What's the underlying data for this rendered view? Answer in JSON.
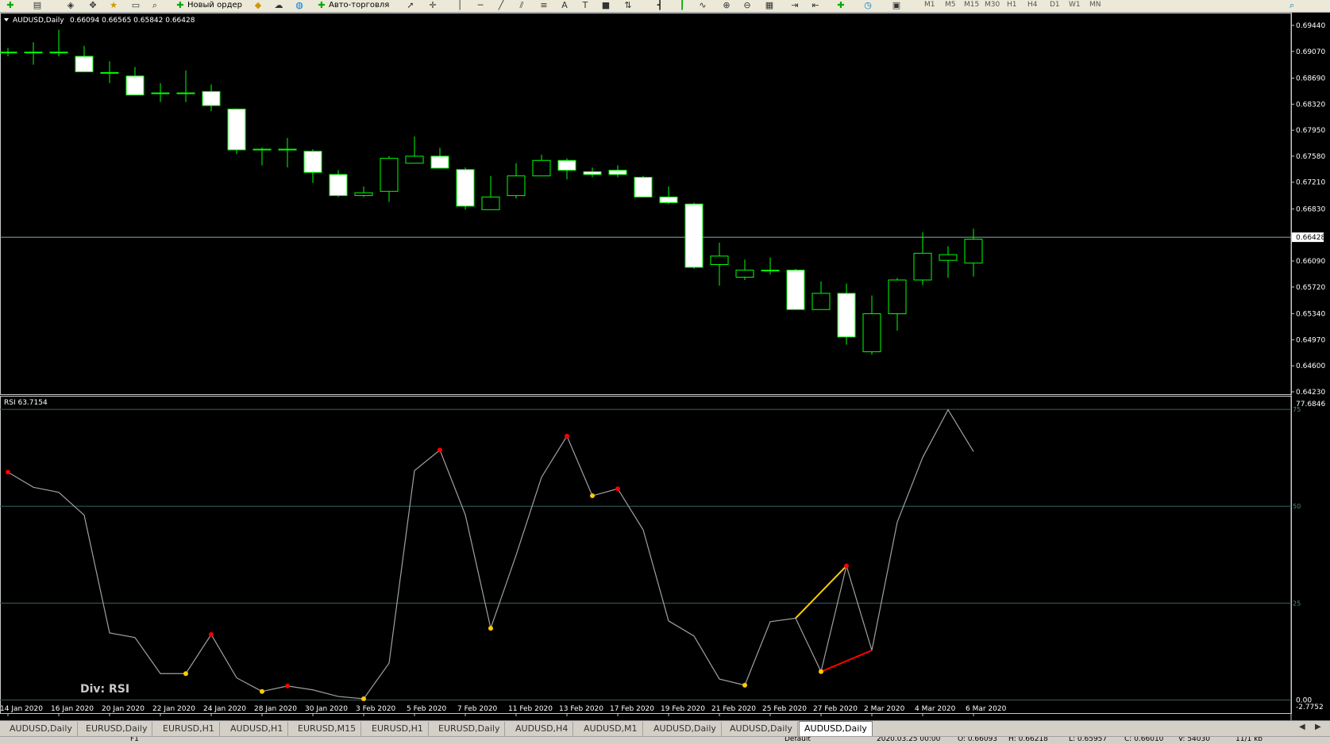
{
  "toolbar": {
    "new_order": "Новый ордер",
    "auto_trading": "Авто-торговля",
    "timeframes": [
      "M1",
      "M5",
      "M15",
      "M30",
      "H1",
      "H4",
      "D1",
      "W1",
      "MN"
    ]
  },
  "tabs": [
    "AUDUSD,Daily",
    "EURUSD,Daily",
    "EURUSD,H1",
    "AUDUSD,H1",
    "EURUSD,M15",
    "EURUSD,H1",
    "EURUSD,Daily",
    "AUDUSD,H4",
    "AUDUSD,M1",
    "AUDUSD,Daily",
    "AUDUSD,Daily",
    "AUDUSD,Daily"
  ],
  "active_tab": 11,
  "status": {
    "help": "F1",
    "profile": "Default",
    "time": "2020.03.25 00:00",
    "open": "O: 0.66093",
    "high": "H: 0.66218",
    "low": "L: 0.65957",
    "close": "C: 0.66010",
    "volume": "V: 54030",
    "traffic": "11/1 kb"
  },
  "colors": {
    "background": "#000000",
    "bull": "#00ff00",
    "bear_body": "#ffffff",
    "rsi_line": "#a0a0a0",
    "level_line": "#2f4f4f",
    "peak_dot": "#ff0000",
    "trough_dot": "#ffcc00",
    "div_bear": "#ff0000",
    "div_bull": "#ffcc00"
  },
  "chart_data": [
    {
      "type": "candlestick",
      "title": "AUDUSD,Daily",
      "ohlc_label": "0.66094 0.66565 0.65842 0.66428",
      "current_price": 0.66428,
      "current_price_label": "0.66428",
      "ylim": [
        0.6423,
        0.6944
      ],
      "y_ticks": [
        "0.69440",
        "0.69070",
        "0.68690",
        "0.68320",
        "0.67950",
        "0.67580",
        "0.67210",
        "0.66830",
        "0.66090",
        "0.65720",
        "0.65340",
        "0.64970",
        "0.64600",
        "0.64230"
      ],
      "x_tick_labels": [
        {
          "bar": 0,
          "label": "14 Jan 2020"
        },
        {
          "bar": 2,
          "label": "16 Jan 2020"
        },
        {
          "bar": 4,
          "label": "20 Jan 2020"
        },
        {
          "bar": 6,
          "label": "22 Jan 2020"
        },
        {
          "bar": 8,
          "label": "24 Jan 2020"
        },
        {
          "bar": 10,
          "label": "28 Jan 2020"
        },
        {
          "bar": 12,
          "label": "30 Jan 2020"
        },
        {
          "bar": 14,
          "label": "3 Feb 2020"
        },
        {
          "bar": 16,
          "label": "5 Feb 2020"
        },
        {
          "bar": 18,
          "label": "7 Feb 2020"
        },
        {
          "bar": 20,
          "label": "11 Feb 2020"
        },
        {
          "bar": 22,
          "label": "13 Feb 2020"
        },
        {
          "bar": 24,
          "label": "17 Feb 2020"
        },
        {
          "bar": 26,
          "label": "19 Feb 2020"
        },
        {
          "bar": 28,
          "label": "21 Feb 2020"
        },
        {
          "bar": 30,
          "label": "25 Feb 2020"
        },
        {
          "bar": 32,
          "label": "27 Feb 2020"
        },
        {
          "bar": 34,
          "label": "2 Mar 2020"
        },
        {
          "bar": 36,
          "label": "4 Mar 2020"
        },
        {
          "bar": 38,
          "label": "6 Mar 2020"
        }
      ],
      "candles": [
        {
          "o": 0.6906,
          "h": 0.6912,
          "l": 0.69,
          "c": 0.6906
        },
        {
          "o": 0.6906,
          "h": 0.692,
          "l": 0.6888,
          "c": 0.6906
        },
        {
          "o": 0.6906,
          "h": 0.6938,
          "l": 0.69,
          "c": 0.6905
        },
        {
          "o": 0.69,
          "h": 0.6915,
          "l": 0.6888,
          "c": 0.6878
        },
        {
          "o": 0.6877,
          "h": 0.6893,
          "l": 0.6862,
          "c": 0.6877
        },
        {
          "o": 0.6872,
          "h": 0.6885,
          "l": 0.6845,
          "c": 0.6845
        },
        {
          "o": 0.6848,
          "h": 0.6862,
          "l": 0.6835,
          "c": 0.6848
        },
        {
          "o": 0.6848,
          "h": 0.688,
          "l": 0.6835,
          "c": 0.6848
        },
        {
          "o": 0.685,
          "h": 0.686,
          "l": 0.6822,
          "c": 0.683
        },
        {
          "o": 0.6825,
          "h": 0.6826,
          "l": 0.6761,
          "c": 0.6767
        },
        {
          "o": 0.6768,
          "h": 0.677,
          "l": 0.6745,
          "c": 0.6768
        },
        {
          "o": 0.6768,
          "h": 0.6784,
          "l": 0.6742,
          "c": 0.6768
        },
        {
          "o": 0.6765,
          "h": 0.6768,
          "l": 0.672,
          "c": 0.6735
        },
        {
          "o": 0.6732,
          "h": 0.6738,
          "l": 0.67,
          "c": 0.6702
        },
        {
          "o": 0.6702,
          "h": 0.6715,
          "l": 0.67,
          "c": 0.6706
        },
        {
          "o": 0.6708,
          "h": 0.6758,
          "l": 0.6693,
          "c": 0.6755
        },
        {
          "o": 0.6748,
          "h": 0.6786,
          "l": 0.6748,
          "c": 0.6758
        },
        {
          "o": 0.6758,
          "h": 0.677,
          "l": 0.6743,
          "c": 0.6741
        },
        {
          "o": 0.6739,
          "h": 0.6742,
          "l": 0.6682,
          "c": 0.6687
        },
        {
          "o": 0.6682,
          "h": 0.673,
          "l": 0.6682,
          "c": 0.67
        },
        {
          "o": 0.6702,
          "h": 0.6748,
          "l": 0.6698,
          "c": 0.673
        },
        {
          "o": 0.673,
          "h": 0.676,
          "l": 0.673,
          "c": 0.6752
        },
        {
          "o": 0.6752,
          "h": 0.6755,
          "l": 0.6725,
          "c": 0.6738
        },
        {
          "o": 0.6736,
          "h": 0.6742,
          "l": 0.6728,
          "c": 0.6732
        },
        {
          "o": 0.6738,
          "h": 0.6745,
          "l": 0.6728,
          "c": 0.6732
        },
        {
          "o": 0.6728,
          "h": 0.673,
          "l": 0.67,
          "c": 0.67
        },
        {
          "o": 0.67,
          "h": 0.6715,
          "l": 0.669,
          "c": 0.6692
        },
        {
          "o": 0.669,
          "h": 0.6692,
          "l": 0.6598,
          "c": 0.66
        },
        {
          "o": 0.6604,
          "h": 0.6635,
          "l": 0.6574,
          "c": 0.6616
        },
        {
          "o": 0.6586,
          "h": 0.6611,
          "l": 0.6582,
          "c": 0.6596
        },
        {
          "o": 0.6596,
          "h": 0.6614,
          "l": 0.659,
          "c": 0.6596
        },
        {
          "o": 0.6596,
          "h": 0.6598,
          "l": 0.654,
          "c": 0.654
        },
        {
          "o": 0.654,
          "h": 0.658,
          "l": 0.654,
          "c": 0.6563
        },
        {
          "o": 0.6563,
          "h": 0.6577,
          "l": 0.649,
          "c": 0.6501
        },
        {
          "o": 0.648,
          "h": 0.656,
          "l": 0.6476,
          "c": 0.6534
        },
        {
          "o": 0.6534,
          "h": 0.6585,
          "l": 0.651,
          "c": 0.6582
        },
        {
          "o": 0.6582,
          "h": 0.665,
          "l": 0.6575,
          "c": 0.662
        },
        {
          "o": 0.661,
          "h": 0.663,
          "l": 0.6585,
          "c": 0.6618
        },
        {
          "o": 0.6606,
          "h": 0.6655,
          "l": 0.6587,
          "c": 0.664
        }
      ]
    },
    {
      "type": "line",
      "title": "RSI 63.7154",
      "ylim": [
        -2.7752,
        77.6846
      ],
      "y_tick_top": "77.6846",
      "y_tick_bottom": "-2.7752",
      "y_tick_zero": "0.00",
      "levels": [
        75,
        50,
        25,
        0
      ],
      "level_labels": [
        "75",
        "50",
        "25"
      ],
      "annotation": "Div:  RSI",
      "series": [
        {
          "values": [
            58.8,
            54.9,
            53.6,
            47.7,
            17.3,
            16.1,
            6.8,
            6.8,
            16.9,
            5.7,
            2.2,
            3.6,
            2.6,
            0.9,
            0.3,
            9.5,
            59.2,
            64.5,
            47.8,
            18.5,
            37.4,
            57.5,
            68.1,
            52.7,
            54.5,
            43.9,
            20.4,
            16.5,
            5.4,
            3.8,
            20.2,
            21.1,
            7.3,
            34.6,
            12.8,
            45.9,
            62.6,
            74.9,
            64.1
          ]
        }
      ],
      "peaks": [
        0,
        8,
        11,
        17,
        22,
        24,
        33
      ],
      "troughs": [
        7,
        10,
        14,
        19,
        23,
        29,
        32
      ],
      "divergences": [
        {
          "from": 31,
          "to": 33,
          "kind": "bull"
        },
        {
          "from": 32,
          "to": 34,
          "kind": "bear"
        }
      ]
    }
  ]
}
